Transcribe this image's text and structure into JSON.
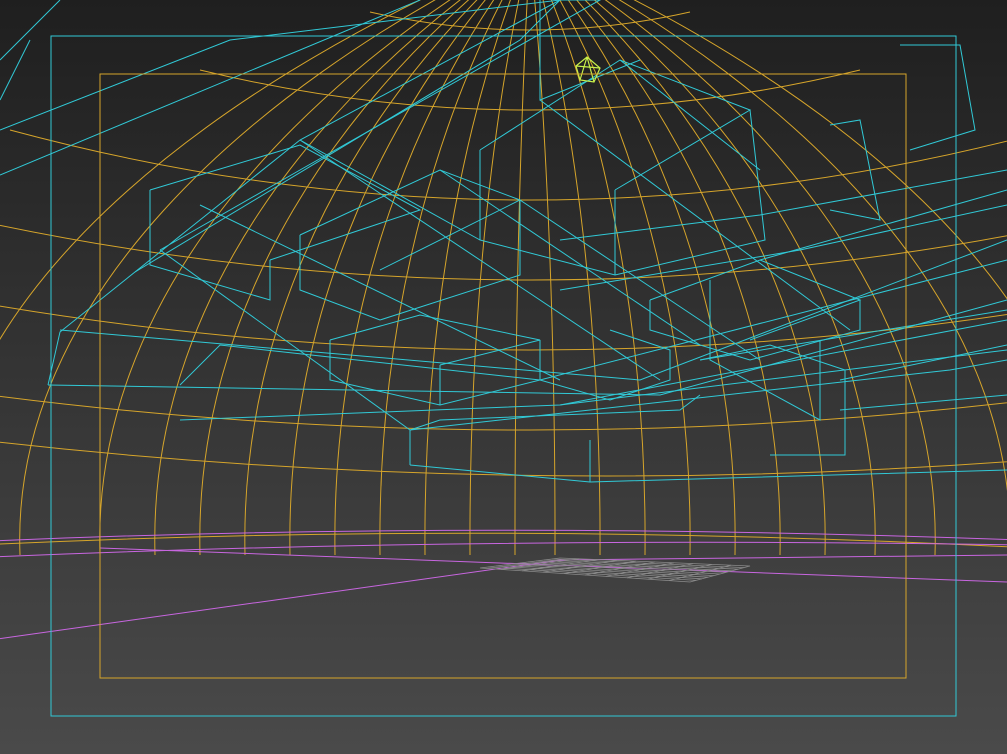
{
  "viewport": {
    "view_type": "perspective-wireframe",
    "background_top": "#1f1f1f",
    "background_bottom": "#4a4a4a"
  },
  "colors": {
    "geometry_wire": "#31c9d6",
    "dome_wire": "#d6a52b",
    "ground_wire": "#c866e0",
    "light_gizmo": "#c8f04a",
    "ground_grid": "#8a8a8a"
  },
  "frames": {
    "safe_frame_outer": "cyan",
    "safe_frame_inner": "gold"
  },
  "icons": {
    "light_gizmo": "light-icon",
    "ground_grid": "grid-icon"
  }
}
